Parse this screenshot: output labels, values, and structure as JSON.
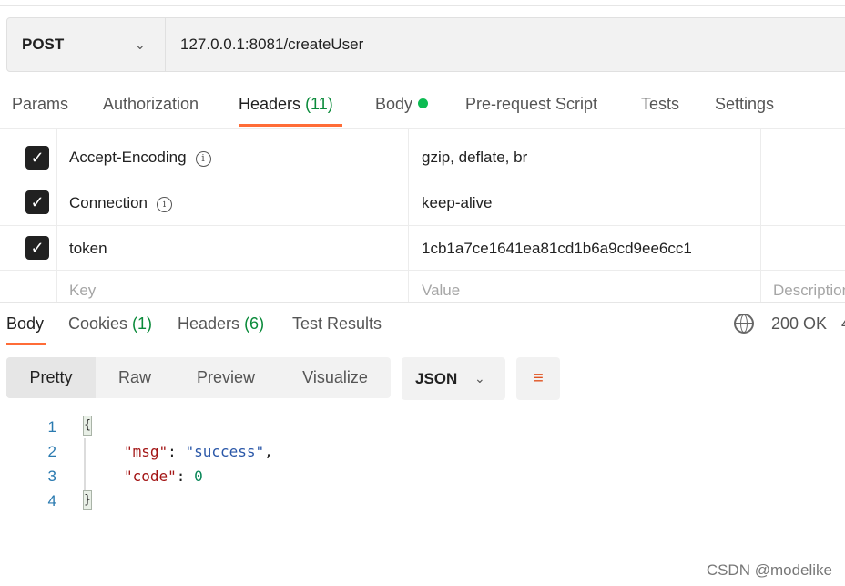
{
  "request": {
    "method": "POST",
    "url": "127.0.0.1:8081/createUser"
  },
  "request_tabs": [
    {
      "label": "Params"
    },
    {
      "label": "Authorization"
    },
    {
      "label": "Headers",
      "count": "(11)"
    },
    {
      "label": "Body"
    },
    {
      "label": "Pre-request Script"
    },
    {
      "label": "Tests"
    },
    {
      "label": "Settings"
    }
  ],
  "headers": [
    {
      "key": "Accept-Encoding",
      "value": "gzip, deflate, br",
      "checked": true,
      "info": true
    },
    {
      "key": "Connection",
      "value": "keep-alive",
      "checked": true,
      "info": true
    },
    {
      "key": "token",
      "value": "1cb1a7ce1641ea81cd1b6a9cd9ee6cc1",
      "checked": true,
      "info": false
    }
  ],
  "placeholders": {
    "key": "Key",
    "value": "Value",
    "description": "Description"
  },
  "response_tabs": [
    {
      "label": "Body"
    },
    {
      "label": "Cookies",
      "count": "(1)"
    },
    {
      "label": "Headers",
      "count": "(6)"
    },
    {
      "label": "Test Results"
    }
  ],
  "status": {
    "code": "200 OK",
    "time_partial": "4"
  },
  "view_modes": [
    "Pretty",
    "Raw",
    "Preview",
    "Visualize"
  ],
  "format": "JSON",
  "code": {
    "lines": [
      "1",
      "2",
      "3",
      "4"
    ],
    "open": "{",
    "close": "}",
    "msg_key": "\"msg\"",
    "msg_value": "\"success\"",
    "code_key": "\"code\"",
    "code_value": "0",
    "colon": ": ",
    "comma": ","
  },
  "watermark": "CSDN @modelike",
  "colors": {
    "accent": "#ff6c37",
    "success": "#0a8a3a"
  }
}
